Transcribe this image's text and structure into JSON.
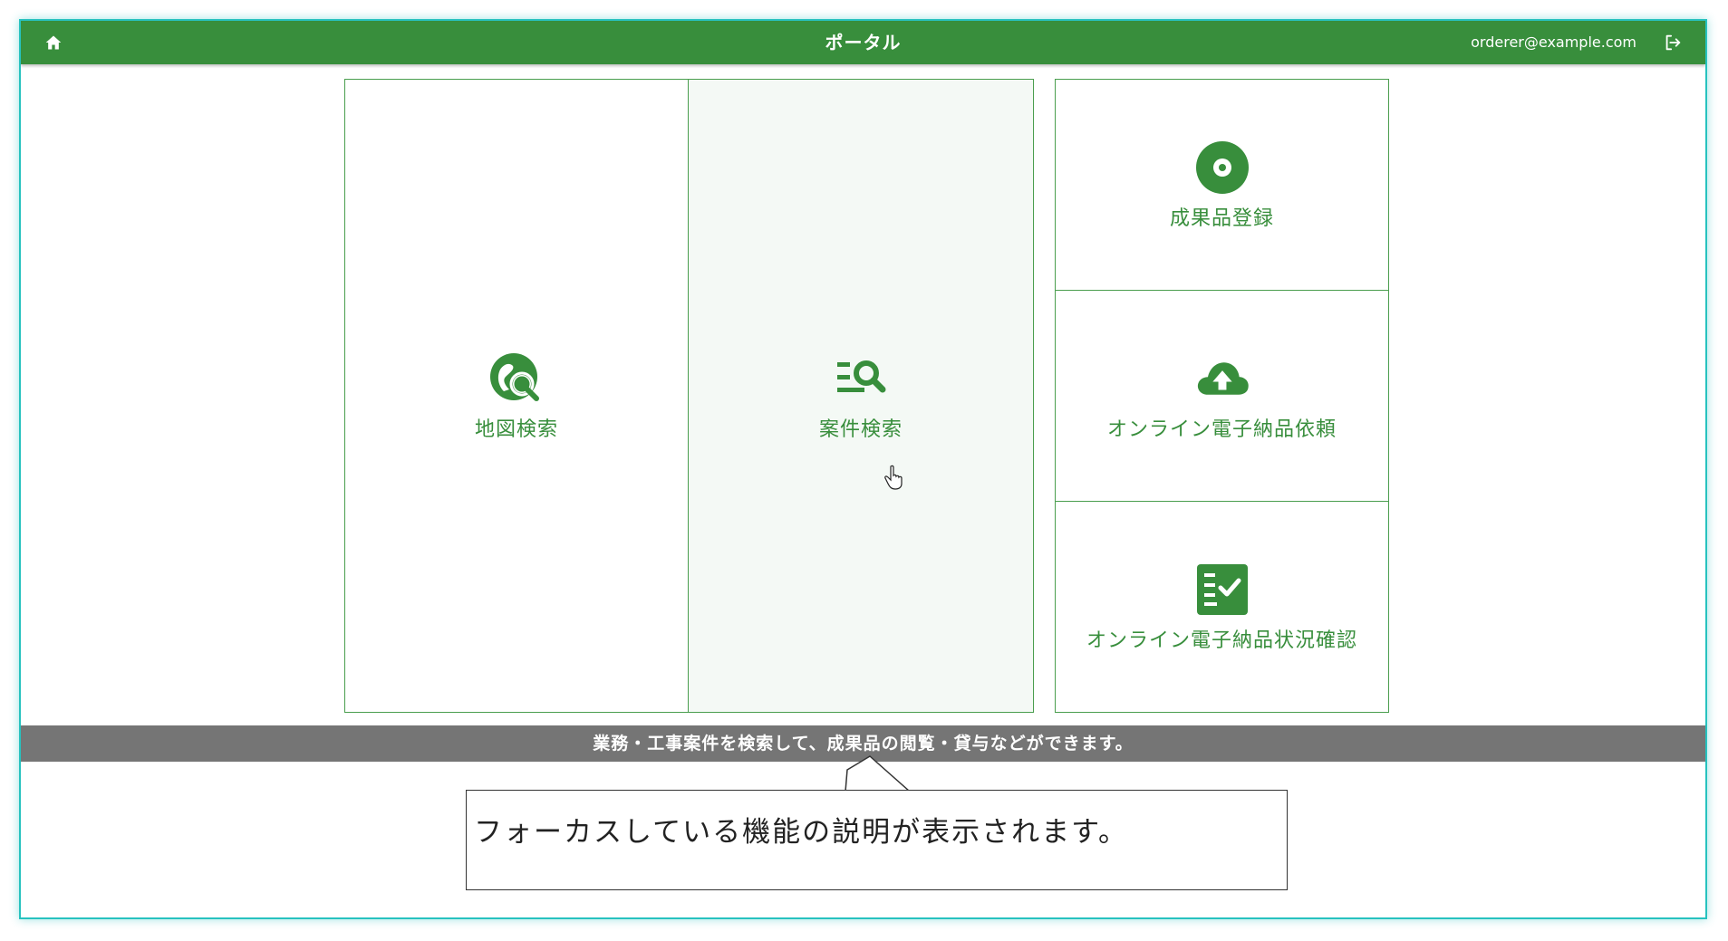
{
  "app": {
    "title": "ポータル",
    "user_email": "orderer@example.com"
  },
  "icons": {
    "home": "home-icon",
    "logout": "logout-icon"
  },
  "tiles": {
    "map_search": {
      "label": "地図検索",
      "icon": "map-search-icon"
    },
    "case_search": {
      "label": "案件検索",
      "icon": "list-search-icon"
    },
    "deliverable_register": {
      "label": "成果品登録",
      "icon": "disc-icon"
    },
    "online_delivery_request": {
      "label": "オンライン電子納品依頼",
      "icon": "cloud-upload-icon"
    },
    "online_delivery_status": {
      "label": "オンライン電子納品状況確認",
      "icon": "checklist-icon"
    }
  },
  "description_bar": {
    "text": "業務・工事案件を検索して、成果品の閲覧・貸与などができます。"
  },
  "callout": {
    "text": "フォーカスしている機能の説明が表示されます。"
  },
  "colors": {
    "header": "#388e3c",
    "accent": "#388e3c",
    "description_bar": "#757575",
    "frame_border": "#27c2bf"
  }
}
